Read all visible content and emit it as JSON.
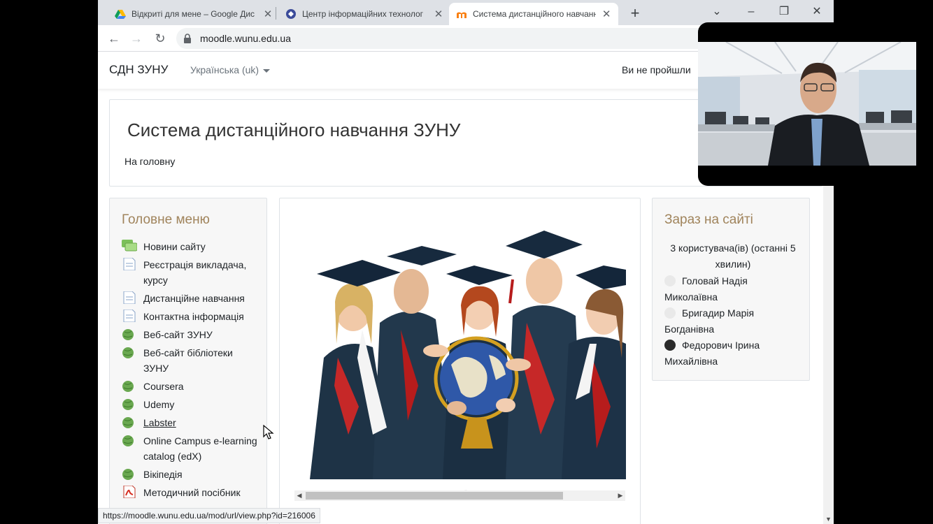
{
  "browser": {
    "tabs": [
      {
        "title": "Відкриті для мене – Google Дис",
        "close": "✕",
        "icon": "google-drive-icon"
      },
      {
        "title": "Центр інформаційних технолог",
        "close": "✕",
        "icon": "globe-favicon-icon"
      },
      {
        "title": "Система дистанційного навчання",
        "close": "✕",
        "icon": "moodle-favicon-icon"
      }
    ],
    "new_tab": "+",
    "window_controls": {
      "chevron": "⌄",
      "minimize": "–",
      "restore": "❐",
      "close": "✕"
    },
    "nav": {
      "back": "←",
      "forward": "→",
      "reload": "↻"
    },
    "url": "moodle.wunu.edu.ua",
    "status_url": "https://moodle.wunu.edu.ua/mod/url/view.php?id=216006"
  },
  "navbar": {
    "brand": "СДН ЗУНУ",
    "language": "Українська (uk)",
    "login_message": "Ви не пройшли"
  },
  "header": {
    "title": "Система дистанційного навчання ЗУНУ",
    "breadcrumb_home": "На головну"
  },
  "main_menu": {
    "title": "Головне меню",
    "items": [
      {
        "label": "Новини сайту",
        "icon": "forum-icon"
      },
      {
        "label": "Реєстрація викладача, курсу",
        "icon": "page-icon"
      },
      {
        "label": "Дистанційне навчання",
        "icon": "page-icon"
      },
      {
        "label": "Контактна інформація",
        "icon": "page-icon"
      },
      {
        "label": "Веб-сайт ЗУНУ",
        "icon": "url-globe-icon"
      },
      {
        "label": "Веб-сайт бібліотеки ЗУНУ",
        "icon": "url-globe-icon"
      },
      {
        "label": "Coursera",
        "icon": "url-globe-icon"
      },
      {
        "label": "Udemy",
        "icon": "url-globe-icon"
      },
      {
        "label": "Labster",
        "icon": "url-globe-icon"
      },
      {
        "label": "Online Campus e-learning catalog (edX)",
        "icon": "url-globe-icon"
      },
      {
        "label": "Вікіпедія",
        "icon": "url-globe-icon"
      },
      {
        "label": "Методичний посібник",
        "icon": "pdf-icon"
      }
    ]
  },
  "online_users": {
    "title": "Зараз на сайті",
    "count_text": "3 користувача(ів) (останні 5 хвилин)",
    "users": [
      {
        "name": "Головай Надія Миколаївна",
        "icon": "default-avatar-icon"
      },
      {
        "name": "Бригадир Марія Богданівна",
        "icon": "default-avatar-icon"
      },
      {
        "name": "Федорович Ірина Михайлівна",
        "icon": "photo-avatar-icon"
      }
    ]
  },
  "slider": {
    "slides": 3,
    "active": 2,
    "scroll_left": "◀",
    "scroll_right": "▶",
    "image": "graduates-globe-photo"
  },
  "colors": {
    "block_title": "#a0845c",
    "page_bg": "#ffffff",
    "block_bg": "#f7f7f7"
  }
}
